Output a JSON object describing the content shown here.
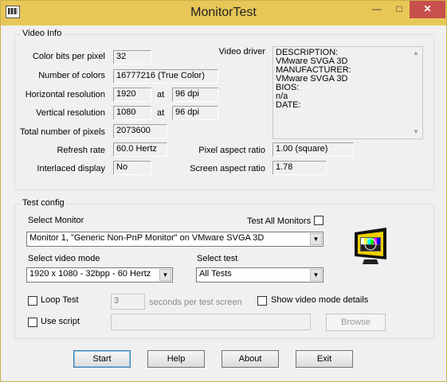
{
  "window": {
    "title": "MonitorTest",
    "minimize": "—",
    "maximize": "□",
    "close": "✕",
    "icon": "monitor-test-app-icon"
  },
  "video_info": {
    "group_title": "Video Info",
    "color_bits_label": "Color bits per pixel",
    "color_bits": "32",
    "num_colors_label": "Number of colors",
    "num_colors": "16777216 (True Color)",
    "h_res_label": "Horizontal resolution",
    "h_res": "1920",
    "at1": "at",
    "h_dpi": "96 dpi",
    "v_res_label": "Vertical resolution",
    "v_res": "1080",
    "at2": "at",
    "v_dpi": "96 dpi",
    "total_pixels_label": "Total number of pixels",
    "total_pixels": "2073600",
    "refresh_label": "Refresh rate",
    "refresh": "60.0 Hertz",
    "interlaced_label": "Interlaced display",
    "interlaced": "No",
    "driver_label": "Video driver",
    "driver_lines": [
      "DESCRIPTION:",
      "VMware SVGA 3D",
      "MANUFACTURER:",
      "VMware SVGA 3D",
      "BIOS:",
      "n/a",
      "DATE:"
    ],
    "pixel_aspect_label": "Pixel aspect ratio",
    "pixel_aspect": "1.00 (square)",
    "screen_aspect_label": "Screen aspect ratio",
    "screen_aspect": "1.78"
  },
  "test_config": {
    "group_title": "Test config",
    "select_monitor_label": "Select Monitor",
    "monitor": "Monitor 1, \"Generic Non-PnP Monitor\" on VMware SVGA 3D",
    "test_all_label": "Test All Monitors",
    "video_mode_label": "Select video mode",
    "video_mode": "1920 x 1080 - 32bpp - 60 Hertz",
    "select_test_label": "Select test",
    "test": "All Tests",
    "loop_label": "Loop Test",
    "loop_seconds": "3",
    "seconds_label": "seconds per test screen",
    "show_details_label": "Show video mode details",
    "use_script_label": "Use script",
    "script_path": "",
    "browse": "Browse"
  },
  "buttons": {
    "start": "Start",
    "help": "Help",
    "about": "About",
    "exit": "Exit"
  }
}
